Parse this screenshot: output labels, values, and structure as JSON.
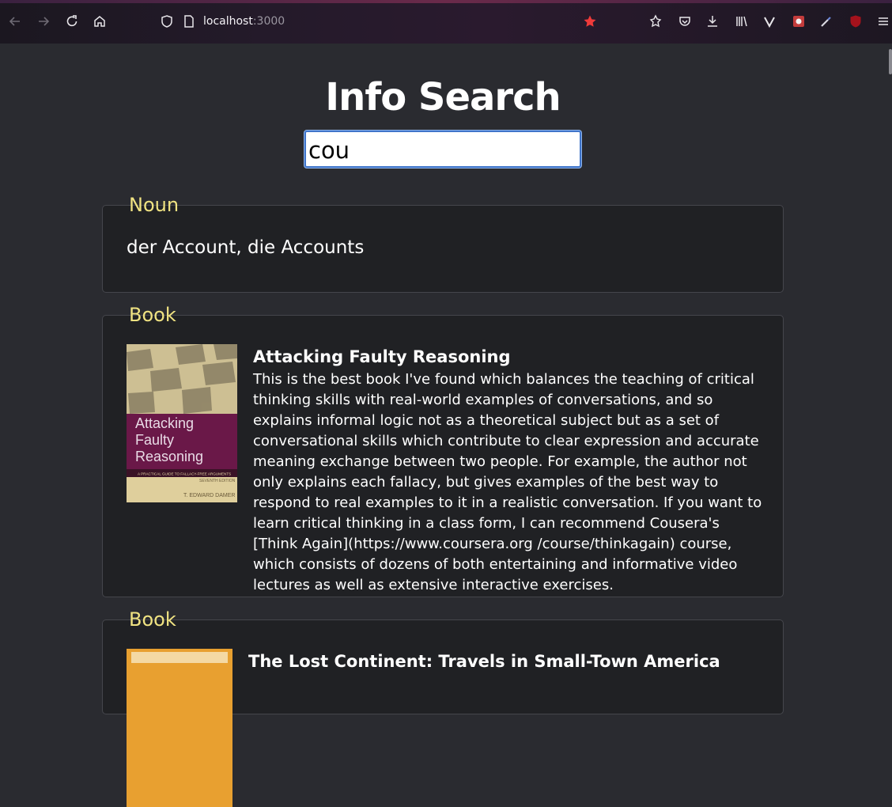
{
  "browser": {
    "url_host": "localhost",
    "url_port": ":3000",
    "colors": {
      "star": "#f03a3a"
    },
    "icons": [
      "back-icon",
      "forward-icon",
      "reload-icon",
      "home-icon",
      "shield-icon",
      "page-icon",
      "star-icon",
      "extension-icon",
      "pocket-icon",
      "download-icon",
      "library-icon",
      "vivaldi-icon",
      "extension-red-icon",
      "eyedropper-icon",
      "ublock-icon",
      "menu-icon"
    ]
  },
  "page": {
    "title": "Info Search",
    "search": {
      "value": "cou",
      "placeholder": ""
    }
  },
  "results": [
    {
      "type": "Noun",
      "text": "der Account, die Accounts"
    },
    {
      "type": "Book",
      "title": "Attacking Faulty Reasoning",
      "cover": {
        "title_line1": "Attacking",
        "title_line2": "Faulty",
        "title_line3": "Reasoning",
        "subtitle": "A PRACTICAL GUIDE TO FALLACY-FREE ARGUMENTS",
        "edition": "SEVENTH EDITION",
        "author": "T. EDWARD DAMER"
      },
      "description": "This is the best book I've found which balances the teaching of critical thinking skills with real-world examples of conversations, and so explains informal logic not as a theoretical subject but as a set of conversational skills which contribute to clear expression and accurate meaning exchange between two people. For example, the author not only explains each fallacy, but gives examples of the best way to respond to real examples to it in a realistic conversation. If you want to learn critical thinking in a class form, I can recommend Cousera's [Think Again](https://www.coursera.org /course/thinkagain) course, which consists of dozens of both entertaining and informative video lectures as well as extensive interactive exercises."
    },
    {
      "type": "Book",
      "title": "The Lost Continent: Travels in Small-Town America"
    }
  ]
}
